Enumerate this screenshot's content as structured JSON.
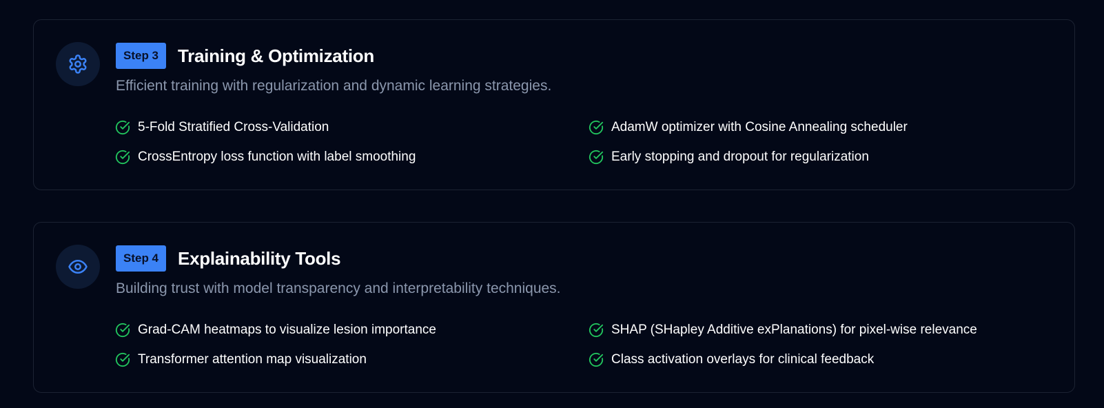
{
  "colors": {
    "background": "#030817",
    "accent": "#3b82f6",
    "check": "#22c55e",
    "muted_text": "#8b97ad"
  },
  "steps": [
    {
      "icon": "gear-icon",
      "badge": "Step 3",
      "title": "Training & Optimization",
      "description": "Efficient training with regularization and dynamic learning strategies.",
      "features": [
        "5-Fold Stratified Cross-Validation",
        "AdamW optimizer with Cosine Annealing scheduler",
        "CrossEntropy loss function with label smoothing",
        "Early stopping and dropout for regularization"
      ]
    },
    {
      "icon": "eye-icon",
      "badge": "Step 4",
      "title": "Explainability Tools",
      "description": "Building trust with model transparency and interpretability techniques.",
      "features": [
        "Grad-CAM heatmaps to visualize lesion importance",
        "SHAP (SHapley Additive exPlanations) for pixel-wise relevance",
        "Transformer attention map visualization",
        "Class activation overlays for clinical feedback"
      ]
    }
  ]
}
